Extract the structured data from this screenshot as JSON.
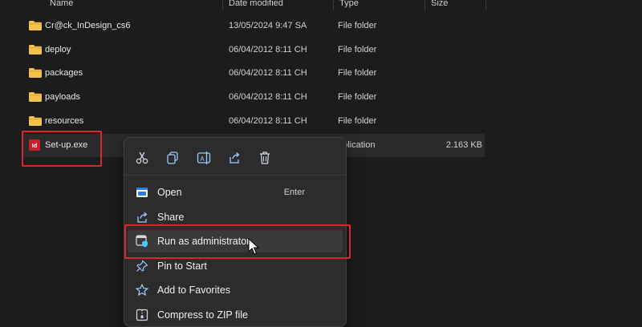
{
  "columns": {
    "name": "Name",
    "date": "Date modified",
    "type": "Type",
    "size": "Size"
  },
  "files": [
    {
      "name": "Cr@ck_InDesign_cs6",
      "date": "13/05/2024 9:47 SA",
      "type": "File folder",
      "size": "",
      "icon": "folder-icon"
    },
    {
      "name": "deploy",
      "date": "06/04/2012 8:11 CH",
      "type": "File folder",
      "size": "",
      "icon": "folder-icon"
    },
    {
      "name": "packages",
      "date": "06/04/2012 8:11 CH",
      "type": "File folder",
      "size": "",
      "icon": "folder-icon"
    },
    {
      "name": "payloads",
      "date": "06/04/2012 8:11 CH",
      "type": "File folder",
      "size": "",
      "icon": "folder-icon"
    },
    {
      "name": "resources",
      "date": "06/04/2012 8:11 CH",
      "type": "File folder",
      "size": "",
      "icon": "folder-icon"
    },
    {
      "name": "Set-up.exe",
      "date": "",
      "type": "pplication",
      "size": "2.163 KB",
      "icon": "exe-icon"
    }
  ],
  "context_menu": {
    "toolbar": [
      "cut-icon",
      "copy-icon",
      "rename-icon",
      "share-icon",
      "delete-icon"
    ],
    "items": [
      {
        "label": "Open",
        "accel": "Enter",
        "icon": "open-icon"
      },
      {
        "label": "Share",
        "accel": "",
        "icon": "share-icon"
      },
      {
        "label": "Run as administrator",
        "accel": "",
        "icon": "shield-icon"
      },
      {
        "label": "Pin to Start",
        "accel": "",
        "icon": "pin-icon"
      },
      {
        "label": "Add to Favorites",
        "accel": "",
        "icon": "star-icon"
      },
      {
        "label": "Compress to ZIP file",
        "accel": "",
        "icon": "zip-icon"
      }
    ]
  },
  "colors": {
    "background": "#1c1c1c",
    "folder": "#f2c14e",
    "highlight": "#e0242b",
    "accent": "#4cc2ff"
  }
}
